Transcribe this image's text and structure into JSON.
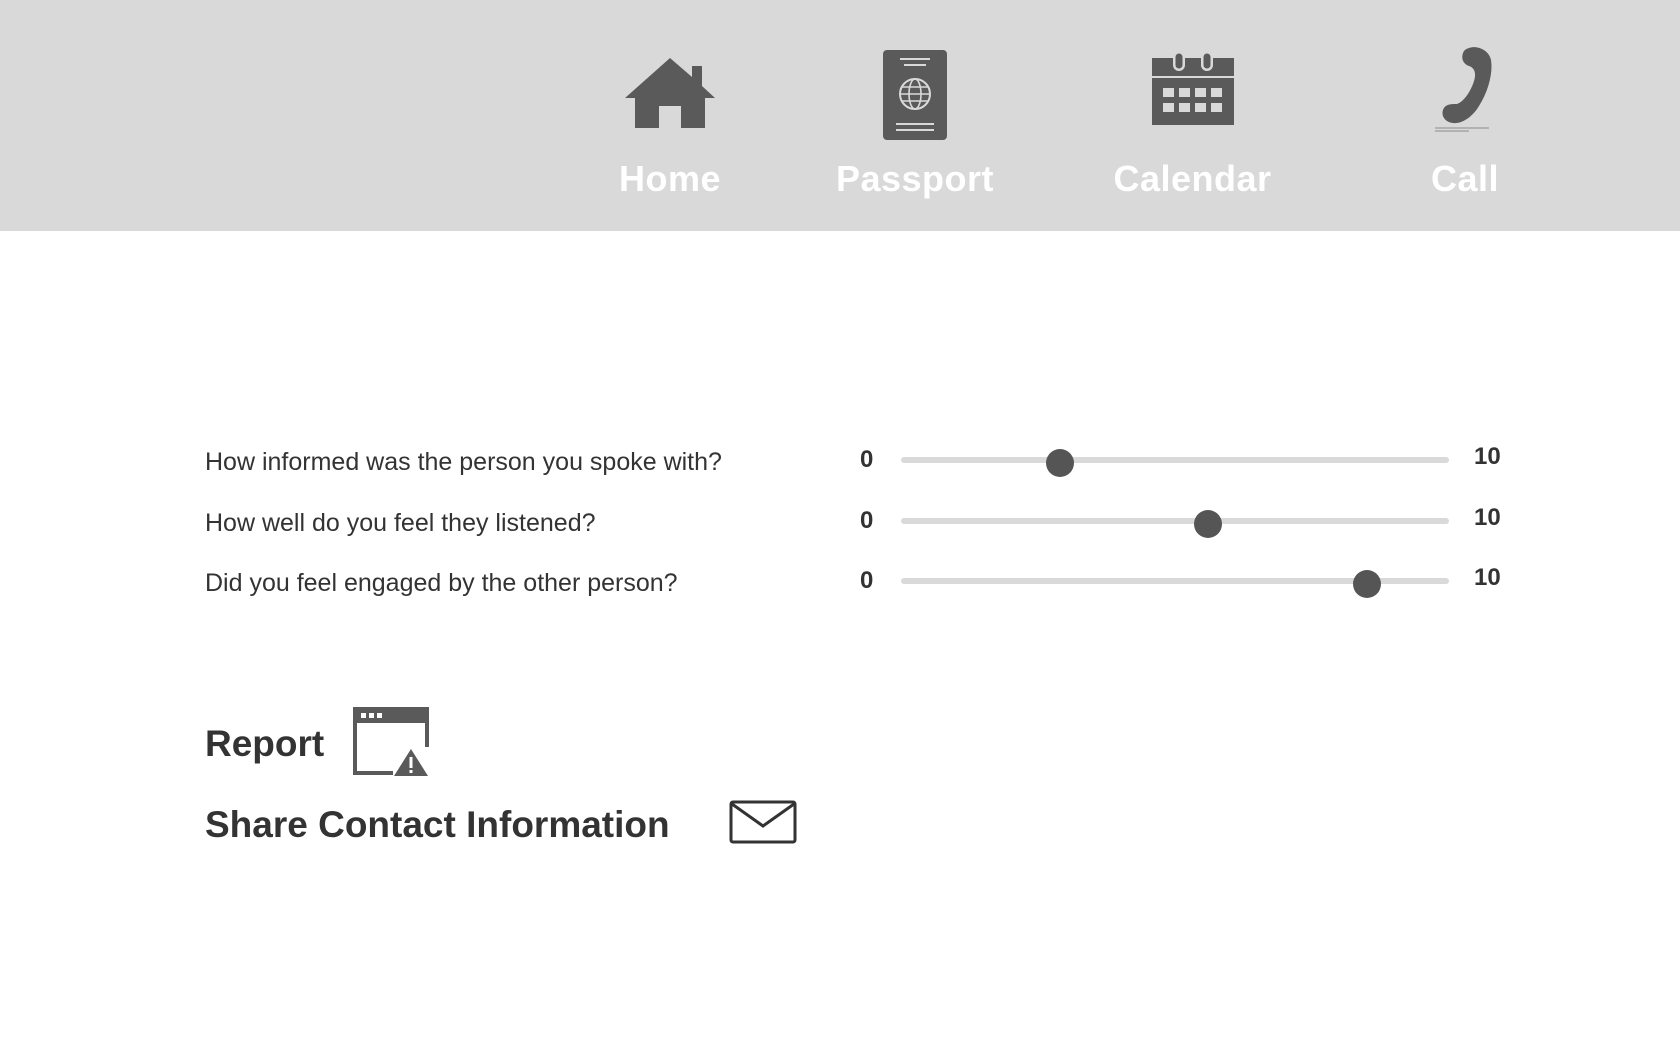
{
  "nav": {
    "items": [
      {
        "label": "Home",
        "icon": "home-icon"
      },
      {
        "label": "Passport",
        "icon": "passport-icon"
      },
      {
        "label": "Calendar",
        "icon": "calendar-icon"
      },
      {
        "label": "Call",
        "icon": "phone-icon"
      }
    ]
  },
  "ratings": [
    {
      "question": "How informed was the person you spoke with?",
      "min": "0",
      "max": "10",
      "value": 2.9
    },
    {
      "question": "How well do you feel they listened?",
      "min": "0",
      "max": "10",
      "value": 5.6
    },
    {
      "question": "Did you feel engaged by the other person?",
      "min": "0",
      "max": "10",
      "value": 8.5
    }
  ],
  "actions": {
    "report_label": "Report",
    "share_label": "Share Contact Information"
  },
  "colors": {
    "topbar": "#d9d9d9",
    "icon": "#5a5a5a",
    "text": "#333333",
    "nav_text": "#ffffff",
    "slider_track": "#d9d9d9",
    "slider_thumb": "#555555"
  }
}
